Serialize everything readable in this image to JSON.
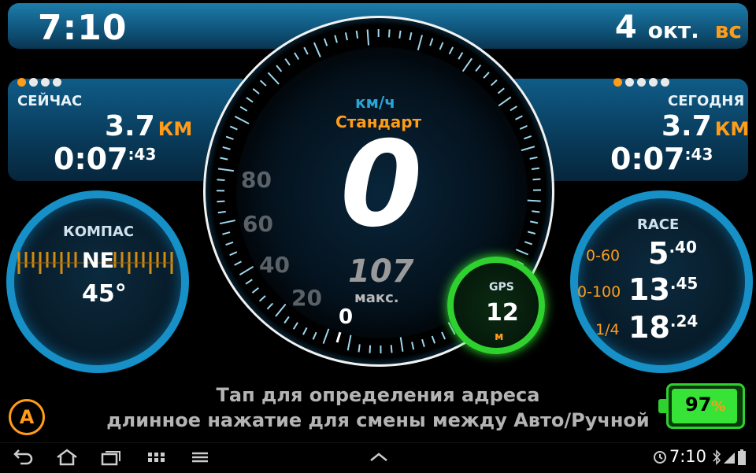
{
  "header": {
    "time": "7:10",
    "day": "4",
    "month": "окт.",
    "weekday": "вс"
  },
  "now_panel": {
    "label": "СЕЙЧАС",
    "distance": "3.7",
    "distance_unit": "КМ",
    "duration": "0:07",
    "duration_sec": ":43",
    "page_dots": 4,
    "active_dot": 1
  },
  "today_panel": {
    "label": "СЕГОДНЯ",
    "distance": "3.7",
    "distance_unit": "КМ",
    "duration": "0:07",
    "duration_sec": ":43",
    "page_dots": 5,
    "active_dot": 1
  },
  "compass": {
    "label": "КОМПАС",
    "direction": "NE",
    "degrees": "45°"
  },
  "speedometer": {
    "unit": "км/ч",
    "mode": "Стандарт",
    "speed": "0",
    "max_speed": "107",
    "max_label": "макс.",
    "scale_labels": [
      "0",
      "20",
      "40",
      "60",
      "80"
    ]
  },
  "gps": {
    "label": "GPS",
    "value": "12",
    "unit": "м"
  },
  "race": {
    "label": "RACE",
    "rows": [
      {
        "name": "0-60",
        "value": "5",
        "fraction": ".40"
      },
      {
        "name": "0-100",
        "value": "13",
        "fraction": ".45"
      },
      {
        "name": "1/4",
        "value": "18",
        "fraction": ".24"
      }
    ]
  },
  "address_hint": {
    "line1": "Тап для определения адреса",
    "line2": "длинное нажатие для смены между Авто/Ручной"
  },
  "mode_button": {
    "label": "A"
  },
  "battery": {
    "level": "97",
    "unit": "%",
    "fraction": 0.97
  },
  "system_bar": {
    "time": "7:10",
    "icons": [
      "back-icon",
      "home-icon",
      "recent-apps-icon",
      "grid-icon",
      "menu-icon",
      "chevron-up-icon",
      "alarm-icon",
      "bluetooth-icon",
      "signal-icon",
      "battery-icon"
    ]
  },
  "colors": {
    "accent": "#ff9c1a",
    "blue": "#1690c6",
    "gps_green": "#2fd12f"
  }
}
